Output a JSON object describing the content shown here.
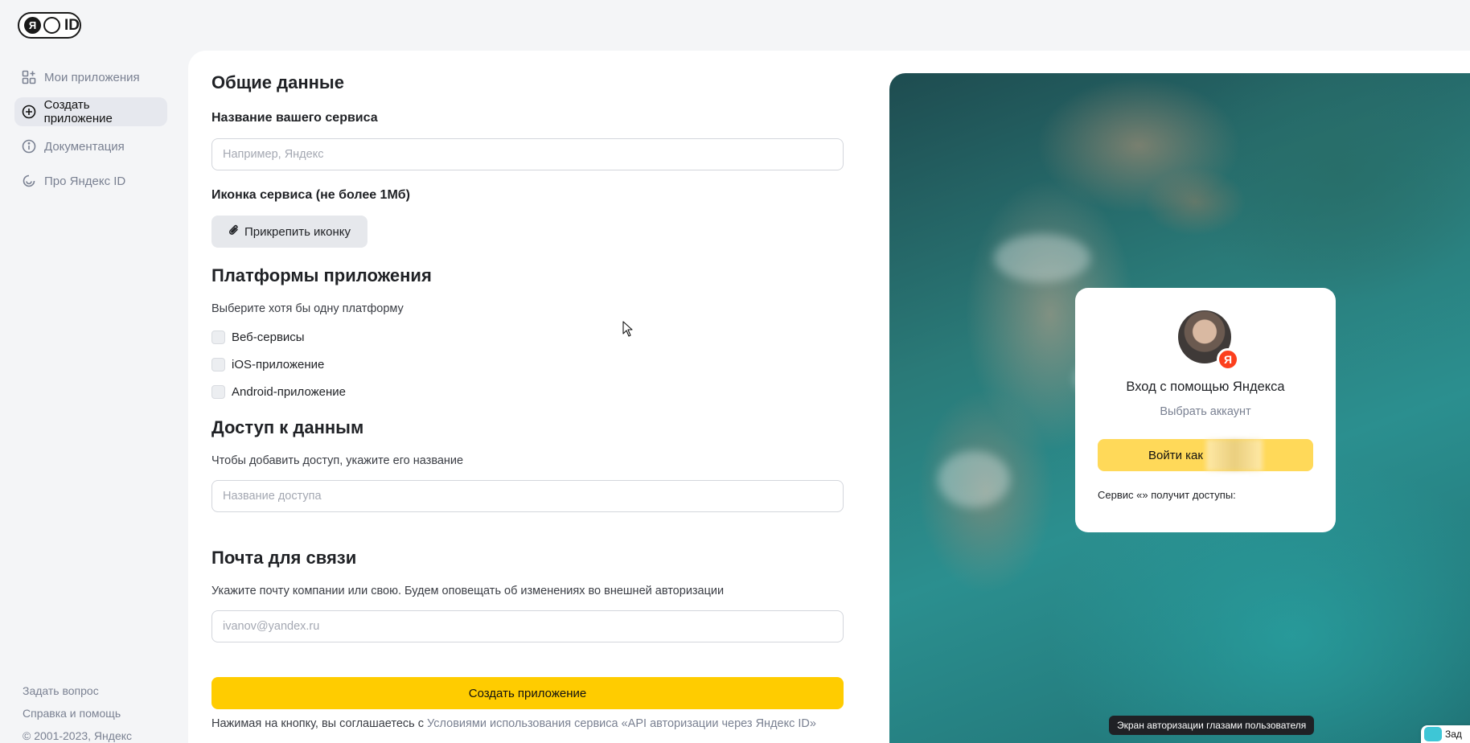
{
  "brand": {
    "logo_ya": "Я",
    "logo_id": "ID"
  },
  "sidebar": {
    "items": [
      {
        "label": "Мои приложения",
        "icon": "apps-add-icon",
        "active": false
      },
      {
        "label": "Создать приложение",
        "icon": "plus-circle-icon",
        "active": true
      },
      {
        "label": "Документация",
        "icon": "info-icon",
        "active": false
      },
      {
        "label": "Про Яндекс ID",
        "icon": "yandex-id-icon",
        "active": false
      }
    ],
    "footer": {
      "ask": "Задать вопрос",
      "help": "Справка и помощь",
      "copyright": "© 2001-2023, Яндекс"
    }
  },
  "form": {
    "general": {
      "heading": "Общие данные",
      "service_name_label": "Название вашего сервиса",
      "service_name_value": "",
      "service_name_placeholder": "Например, Яндекс",
      "icon_label": "Иконка сервиса (не более 1Мб)",
      "attach_button": "Прикрепить иконку"
    },
    "platforms": {
      "heading": "Платформы приложения",
      "hint": "Выберите хотя бы одну платформу",
      "options": [
        {
          "label": "Веб-сервисы",
          "checked": false
        },
        {
          "label": "iOS-приложение",
          "checked": false
        },
        {
          "label": "Android-приложение",
          "checked": false
        }
      ]
    },
    "access": {
      "heading": "Доступ к данным",
      "hint": "Чтобы добавить доступ, укажите его название",
      "value": "",
      "placeholder": "Название доступа"
    },
    "contact": {
      "heading": "Почта для связи",
      "hint": "Укажите почту компании или свою. Будем оповещать об изменениях во внешней авторизации",
      "value": "",
      "placeholder": "ivanov@yandex.ru"
    },
    "submit_button": "Создать приложение",
    "terms_prefix": "Нажимая на кнопку, вы соглашаетесь с ",
    "terms_link": "Условиями использования сервиса «API авторизации через Яндекс ID»"
  },
  "preview": {
    "card_title": "Вход с помощью Яндекса",
    "choose_account": "Выбрать аккаунт",
    "login_button": "Войти как",
    "access_note": "Сервис «» получит доступы:",
    "badge_letter": "Я",
    "caption": "Экран авторизации глазами пользователя"
  },
  "chat_widget": {
    "label": "Зад"
  },
  "colors": {
    "primary_button": "#ffcc00",
    "login_button": "#ffd959",
    "yandex_red": "#fc3f1d",
    "muted_text": "#7a8192"
  }
}
